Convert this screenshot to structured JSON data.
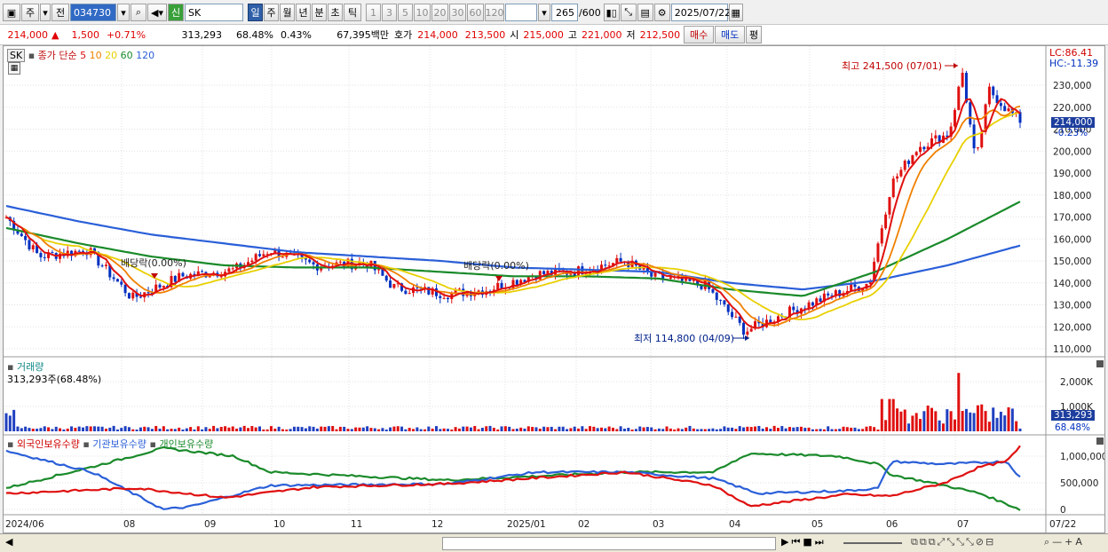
{
  "toolbar": {
    "type_label": "주",
    "mode_label": "전",
    "stock_code": "034730",
    "sin_label": "신",
    "stock_name": "SK",
    "periods": [
      "일",
      "주",
      "월",
      "년",
      "분",
      "초",
      "틱"
    ],
    "selected_period": "일",
    "intervals": [
      "1",
      "3",
      "5",
      "10",
      "20",
      "30",
      "60",
      "120"
    ],
    "count_display": "265",
    "count_total": "/600",
    "date": "2025/07/22"
  },
  "quote": {
    "price": "214,000",
    "change_arrow": "▲",
    "change": "1,500",
    "change_pct": "+0.71%",
    "volume": "313,293",
    "volume_ratio": "68.48%",
    "turnover": "0.43%",
    "trade_value": "67,395백만",
    "hoga_label": "호가",
    "ask": "214,000",
    "bid": "213,500",
    "open_label": "시",
    "open": "215,000",
    "high_label": "고",
    "high": "221,000",
    "low_label": "저",
    "low": "212,500",
    "buy_label": "매수",
    "sell_label": "매도",
    "eval_label": "평"
  },
  "legend": {
    "name": "SK",
    "type": "종가 단순",
    "ma": [
      {
        "label": "5",
        "color": "#e01010"
      },
      {
        "label": "10",
        "color": "#f08000"
      },
      {
        "label": "20",
        "color": "#e8d000"
      },
      {
        "label": "60",
        "color": "#1a8a2a"
      },
      {
        "label": "120",
        "color": "#2a5fd8"
      }
    ]
  },
  "price_panel": {
    "lc": "LC:86.41",
    "hc": "HC:-11.39",
    "current_price_tag": "214,000",
    "current_pct_tag": "-0.23%",
    "high_annotation": "최고 241,500 (07/01)",
    "low_annotation": "최저 114,800 (04/09)",
    "dividend_labels": [
      "배당락(0.00%)",
      "배당락(0.00%)"
    ],
    "y_ticks": [
      "230,000",
      "220,000",
      "210,000",
      "200,000",
      "190,000",
      "180,000",
      "170,000",
      "160,000",
      "150,000",
      "140,000",
      "130,000",
      "120,000",
      "110,000"
    ]
  },
  "volume_panel": {
    "title": "거래량",
    "value": "313,293주(68.48%)",
    "y_ticks": [
      "2,000K",
      "1,000K"
    ],
    "current_tag": "313,293",
    "current_pct": "68.48%"
  },
  "holding_panel": {
    "series": [
      {
        "name": "외국인보유수량",
        "color": "#e01010"
      },
      {
        "name": "기관보유수량",
        "color": "#2a5fd8"
      },
      {
        "name": "개인보유수량",
        "color": "#1a8a2a"
      }
    ],
    "y_ticks": [
      "1,000,000",
      "500,000",
      "0"
    ]
  },
  "x_axis": [
    "2024/06",
    "08",
    "09",
    "10",
    "11",
    "12",
    "2025/01",
    "02",
    "03",
    "04",
    "05",
    "06",
    "07",
    "07/22"
  ],
  "chart_data": {
    "type": "line",
    "title": "SK",
    "x": [
      "2024/06",
      "08",
      "09",
      "10",
      "11",
      "12",
      "2025/01",
      "02",
      "03",
      "04",
      "05",
      "06",
      "07"
    ],
    "series": [
      {
        "name": "5",
        "values": [
          170000,
          152000,
          138000,
          146000,
          152000,
          148000,
          133000,
          143000,
          147000,
          139000,
          120000,
          138000,
          198000,
          222000,
          214000
        ]
      },
      {
        "name": "60",
        "values": [
          165000,
          158000,
          152000,
          148000,
          147000,
          147000,
          145000,
          143000,
          143000,
          142000,
          137000,
          134000,
          145000,
          160000,
          177000
        ]
      },
      {
        "name": "120",
        "values": [
          175000,
          168000,
          162000,
          158000,
          154000,
          152000,
          150000,
          147000,
          146000,
          145000,
          140000,
          137000,
          141000,
          148000,
          157000
        ]
      }
    ],
    "ylim": [
      110000,
      240000
    ],
    "high": {
      "value": 241500,
      "date": "07/01"
    },
    "low": {
      "value": 114800,
      "date": "04/09"
    }
  }
}
